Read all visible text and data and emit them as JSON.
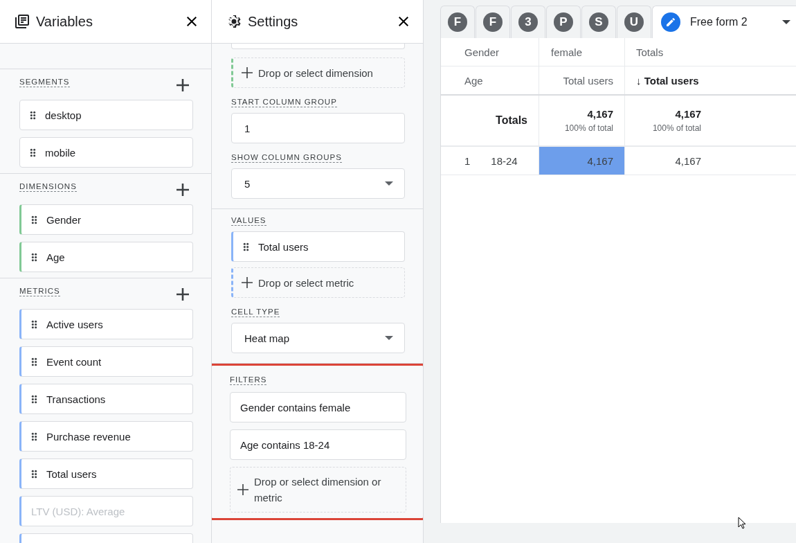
{
  "variables": {
    "title": "Variables",
    "segments": {
      "label": "SEGMENTS",
      "items": [
        {
          "label": "desktop"
        },
        {
          "label": "mobile"
        }
      ]
    },
    "dimensions": {
      "label": "DIMENSIONS",
      "items": [
        {
          "label": "Gender"
        },
        {
          "label": "Age"
        }
      ]
    },
    "metrics": {
      "label": "METRICS",
      "items": [
        {
          "label": "Active users",
          "disabled": false
        },
        {
          "label": "Event count",
          "disabled": false
        },
        {
          "label": "Transactions",
          "disabled": false
        },
        {
          "label": "Purchase revenue",
          "disabled": false
        },
        {
          "label": "Total users",
          "disabled": false
        },
        {
          "label": "LTV (USD): Average",
          "disabled": true
        }
      ]
    }
  },
  "settings": {
    "title": "Settings",
    "dimension_drop": "Drop or select dimension",
    "fields": [
      {
        "kind": "input",
        "label": "START COLUMN GROUP",
        "value": "1"
      },
      {
        "kind": "select",
        "label": "SHOW COLUMN GROUPS",
        "value": "5"
      }
    ],
    "values": {
      "label": "VALUES",
      "items": [
        {
          "label": "Total users"
        }
      ],
      "drop": "Drop or select metric"
    },
    "cell_type": {
      "label": "CELL TYPE",
      "value": "Heat map"
    },
    "filters": {
      "label": "FILTERS",
      "highlighted": true,
      "items": [
        {
          "label": "Gender contains female"
        },
        {
          "label": "Age contains 18-24"
        }
      ],
      "drop": "Drop or select dimension or metric"
    }
  },
  "tabs": [
    {
      "label": "F",
      "selected": false
    },
    {
      "label": "F",
      "selected": false
    },
    {
      "label": "3",
      "selected": false
    },
    {
      "label": "P",
      "selected": false
    },
    {
      "label": "S",
      "selected": false
    },
    {
      "label": "U",
      "selected": false
    },
    {
      "label": "Free form 2",
      "selected": true
    }
  ],
  "table": {
    "header_rows": [
      [
        {
          "label": "Gender",
          "sorted": false
        },
        {
          "label": "female",
          "sorted": false
        },
        {
          "label": "Totals",
          "sorted": false
        }
      ],
      [
        {
          "label": "Age",
          "sorted": false
        },
        {
          "label": "Total users",
          "sorted": false
        },
        {
          "label": "Total users",
          "sorted": true
        }
      ]
    ],
    "sort_arrow": "↓",
    "totals": {
      "label": "Totals",
      "cells": [
        {
          "value": "4,167",
          "share": "100% of total"
        },
        {
          "value": "4,167",
          "share": "100% of total"
        }
      ]
    },
    "rows": [
      {
        "index": "1",
        "label": "18-24",
        "cells": [
          {
            "value": "4,167",
            "color": "#6d9eeb"
          },
          {
            "value": "4,167"
          }
        ]
      }
    ]
  }
}
